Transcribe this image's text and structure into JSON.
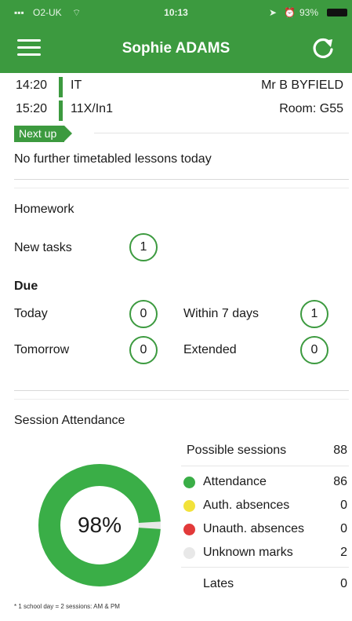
{
  "status": {
    "carrier": "O2-UK",
    "time": "10:13",
    "battery": "93%"
  },
  "header": {
    "title": "Sophie ADAMS",
    "menu_icon": "hamburger-menu-icon",
    "refresh_icon": "refresh-icon"
  },
  "lessons": [
    {
      "time": "14:20",
      "subject": "IT",
      "detail": "Mr B BYFIELD"
    },
    {
      "time": "15:20",
      "subject": "11X/In1",
      "detail": "Room: G55"
    }
  ],
  "next_up": {
    "label": "Next up",
    "message": "No further timetabled lessons today"
  },
  "homework": {
    "title": "Homework",
    "new_tasks_label": "New tasks",
    "new_tasks": "1",
    "due_label": "Due",
    "today_label": "Today",
    "today": "0",
    "within7_label": "Within 7 days",
    "within7": "1",
    "tomorrow_label": "Tomorrow",
    "tomorrow": "0",
    "extended_label": "Extended",
    "extended": "0"
  },
  "attendance": {
    "title": "Session Attendance",
    "percent_label": "98%",
    "percent": 98,
    "possible_label": "Possible sessions",
    "possible": "88",
    "rows": [
      {
        "label": "Attendance",
        "value": "86",
        "color": "#3aae47"
      },
      {
        "label": "Auth. absences",
        "value": "0",
        "color": "#f2e23a"
      },
      {
        "label": "Unauth. absences",
        "value": "0",
        "color": "#e23a3a"
      },
      {
        "label": "Unknown marks",
        "value": "2",
        "color": "#e8e8e8"
      }
    ],
    "lates_label": "Lates",
    "lates": "0"
  },
  "footnote": "* 1 school day = 2 sessions: AM & PM",
  "colors": {
    "brand": "#3c9a3f",
    "ring_track": "#e8e8e8"
  }
}
